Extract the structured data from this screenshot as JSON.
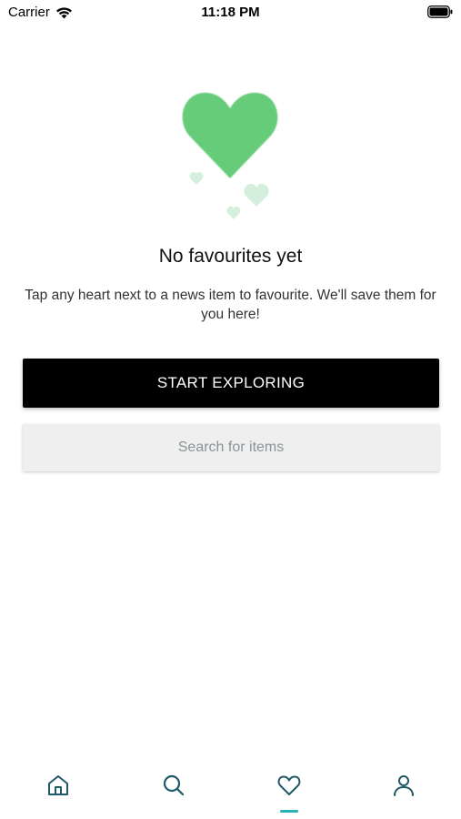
{
  "status_bar": {
    "carrier": "Carrier",
    "time": "11:18 PM"
  },
  "illustration": {
    "icon": "heart-icon",
    "main_color": "#66cc7a",
    "small_color": "#d4efdc"
  },
  "empty_state": {
    "title": "No favourites yet",
    "message": "Tap any heart next to a news item to favourite. We'll save them for you here!"
  },
  "actions": {
    "start_exploring_label": "START EXPLORING",
    "search_label": "Search for items"
  },
  "tab_bar": {
    "tabs": [
      {
        "name": "home",
        "icon": "home-icon"
      },
      {
        "name": "search",
        "icon": "search-icon"
      },
      {
        "name": "favourites",
        "icon": "heart-icon",
        "active": true
      },
      {
        "name": "profile",
        "icon": "user-icon"
      }
    ],
    "icon_color": "#1f5a66",
    "active_indicator_color": "#2ab3b3"
  }
}
